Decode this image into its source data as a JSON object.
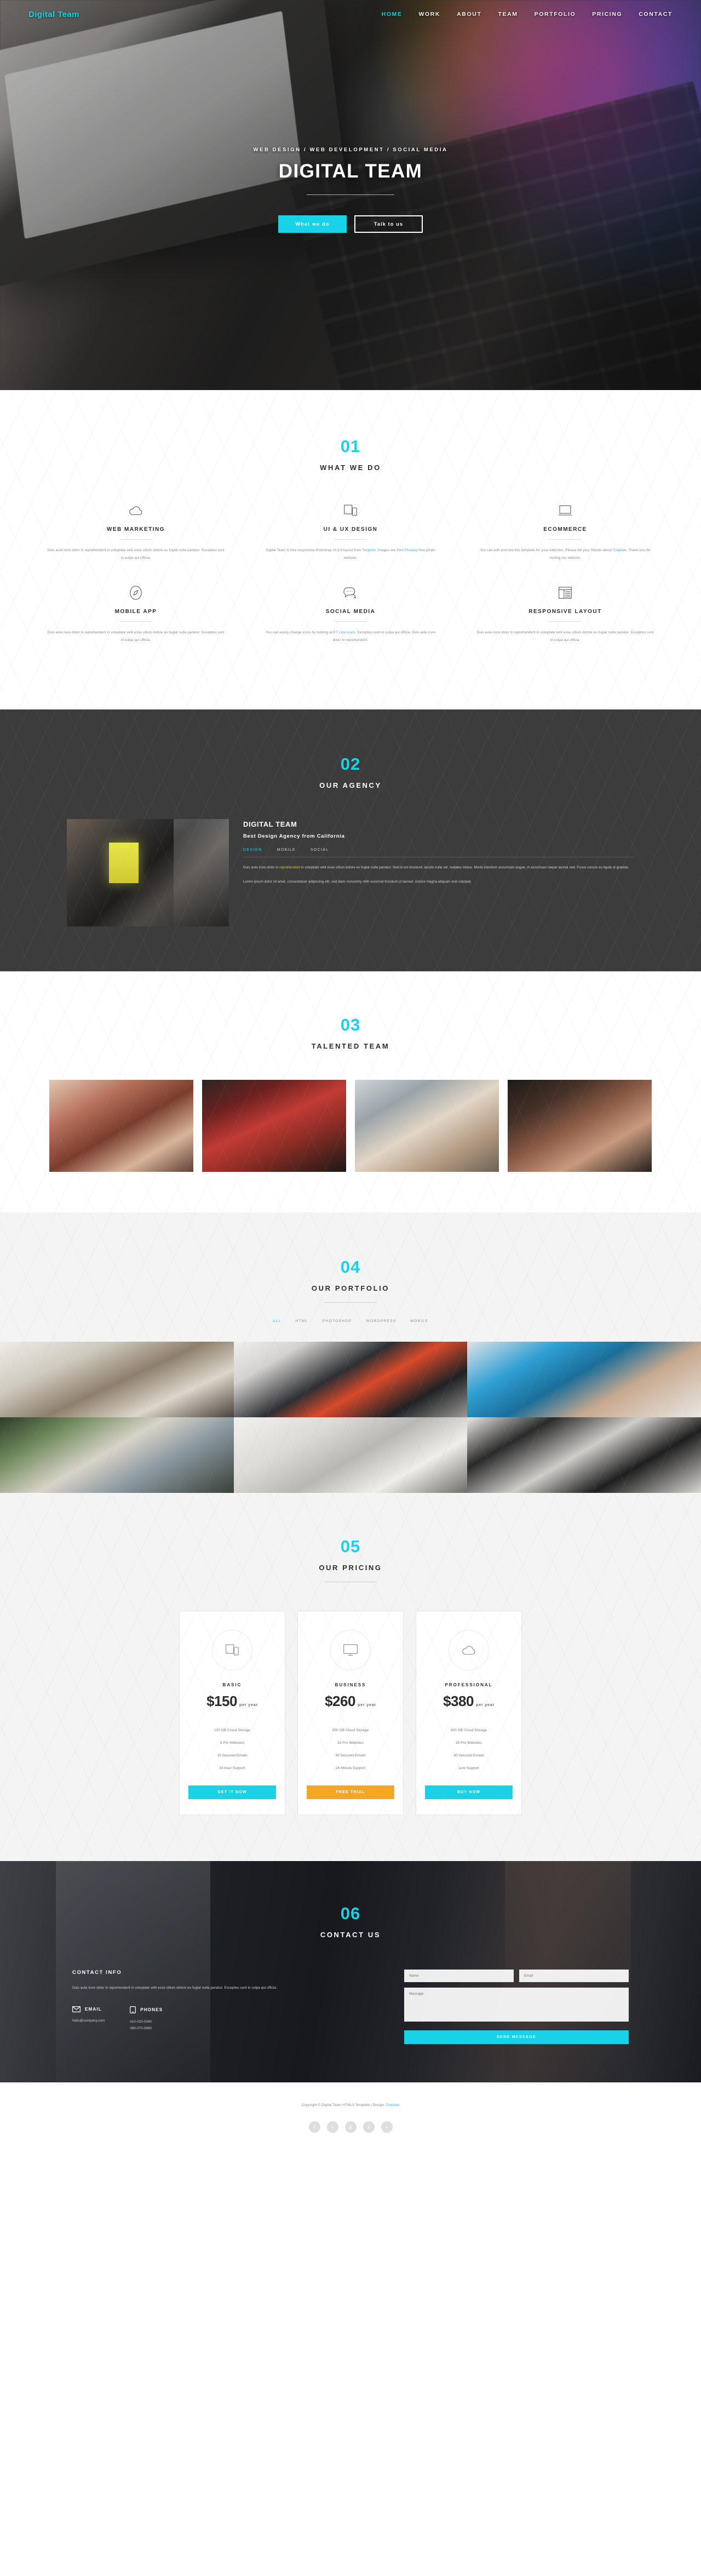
{
  "brand": "Digital Team",
  "nav": {
    "items": [
      {
        "label": "HOME",
        "active": true
      },
      {
        "label": "WORK",
        "active": false
      },
      {
        "label": "ABOUT",
        "active": false
      },
      {
        "label": "TEAM",
        "active": false
      },
      {
        "label": "PORTFOLIO",
        "active": false
      },
      {
        "label": "PRICING",
        "active": false
      },
      {
        "label": "CONTACT",
        "active": false
      }
    ]
  },
  "hero": {
    "subtitle": "WEB DESIGN / WEB DEVELOPMENT / SOCIAL MEDIA",
    "title": "DIGITAL TEAM",
    "primary_button": "What we do",
    "secondary_button": "Talk to us"
  },
  "whatwedo": {
    "number": "01",
    "title": "WHAT WE DO",
    "services": [
      {
        "icon": "cloud-icon",
        "name": "WEB MARKETING",
        "text": "Duis aute irure dolor in reprehenderit in voluptate velit esse cillum dolore eu fugiat nulla pariatur. Excepteu sunt in culpa qui officia."
      },
      {
        "icon": "devices-icon",
        "name": "UI & UX DESIGN",
        "text": "Digital Team is free responsive Bootstrap v3.3.5 layout from Tooplate. Images are from Pixabay free photo website."
      },
      {
        "icon": "laptop-icon",
        "name": "ECOMMERCE",
        "text": "You can edit and use this template for your websites. Please tell your friends about Tooplate. Thank you for visiting our website."
      },
      {
        "icon": "compass-icon",
        "name": "MOBILE APP",
        "text": "Duis aute irure dolor in reprehenderit in voluptate velit esse cillum dolore eu fugiat nulla pariatur. Excepteu sunt in culpa qui officia."
      },
      {
        "icon": "chat-icon",
        "name": "SOCIAL MEDIA",
        "text": "You can easily change icons by looking at ET Line Icons. Excepteu sunt in culpa qui officia. Duis aute irure dolor in reprehenderit."
      },
      {
        "icon": "layout-icon",
        "name": "RESPONSIVE LAYOUT",
        "text": "Duis aute irure dolor in reprehenderit in voluptate velit esse cillum dolore eu fugiat nulla pariatur. Excepteu sunt in culpa qui officia."
      }
    ]
  },
  "agency": {
    "number": "02",
    "title": "OUR AGENCY",
    "heading": "DIGITAL TEAM",
    "subheading": "Best Design Agency from California",
    "tabs": [
      {
        "label": "DESIGN",
        "active": true
      },
      {
        "label": "MOBILE",
        "active": false
      },
      {
        "label": "SOCIAL",
        "active": false
      }
    ],
    "paragraph_1_pre": "Duis aute irure dolor in ",
    "paragraph_1_hl": "reprehenderit",
    "paragraph_1_post": " in voluptate velit esse cillum dolore eu fugiat nulla pariatur. Sed id est tincidunt, iaculis nulla vel, sodales metus. Morbi interdum accumsan augue, in accumsan neque lacinia sed. Fusce cursus eu ligula ut gravida.",
    "paragraph_2": "Lorem ipsum dolor sit amet, consectetuer adipiscing elit, sed diam nonummy nibh euismod tincidunt ut laoreet. Dolore magna aliquam erat volutpat."
  },
  "team": {
    "number": "03",
    "title": "TALENTED TEAM",
    "members": [
      {
        "name": "team-member-1"
      },
      {
        "name": "team-member-2"
      },
      {
        "name": "team-member-3"
      },
      {
        "name": "team-member-4"
      }
    ]
  },
  "portfolio": {
    "number": "04",
    "title": "OUR PORTFOLIO",
    "filters": [
      {
        "label": "ALL",
        "active": true
      },
      {
        "label": "HTML",
        "active": false
      },
      {
        "label": "PHOTOSHOP",
        "active": false
      },
      {
        "label": "WORDPRESS",
        "active": false
      },
      {
        "label": "MOBILE",
        "active": false
      }
    ],
    "items": [
      {
        "name": "portfolio-item-1"
      },
      {
        "name": "portfolio-item-2"
      },
      {
        "name": "portfolio-item-3"
      },
      {
        "name": "portfolio-item-4"
      },
      {
        "name": "portfolio-item-5"
      },
      {
        "name": "portfolio-item-6"
      }
    ]
  },
  "pricing": {
    "number": "05",
    "title": "OUR PRICING",
    "plans": [
      {
        "icon": "devices-icon",
        "name": "BASIC",
        "price": "$150",
        "period": "per year",
        "features": [
          "100 GB Cloud Storage",
          "5 Pro Websites",
          "10 Secured Emails",
          "24-hour Support"
        ],
        "button": "GET IT NOW",
        "button_color": "#18d3e8"
      },
      {
        "icon": "monitor-icon",
        "name": "BUSINESS",
        "price": "$260",
        "period": "per year",
        "features": [
          "500 GB Cloud Storage",
          "24 Pro Websites",
          "30 Secured Emails",
          "24-Minute Support"
        ],
        "button": "FREE TRIAL",
        "button_color": "#f5a623"
      },
      {
        "icon": "cloud-icon",
        "name": "PROFESSIONAL",
        "price": "$380",
        "period": "per year",
        "features": [
          "900 GB Cloud Storage",
          "28 Pro Websites",
          "40 Secured Emails",
          "Live Support"
        ],
        "button": "BUY NOW",
        "button_color": "#18d3e8"
      }
    ]
  },
  "contact": {
    "number": "06",
    "title": "CONTACT US",
    "info_heading": "CONTACT INFO",
    "info_text": "Duis aute irure dolor in reprehenderit in voluptate velit esse cillum dolore eu fugiat nulla pariatur. Excepteu sunt in culpa qui officia.",
    "email_label": "EMAIL",
    "email_value": "hello@company.com",
    "phones_label": "PHONES",
    "phones_value": "010-020-0340\n060-070-0890",
    "form": {
      "name_placeholder": "Name",
      "email_placeholder": "Email",
      "message_placeholder": "Message",
      "submit_label": "SEND MESSAGE"
    }
  },
  "footer": {
    "copyright_pre": "Copyright © Digital Team HTML5 Template | Design: ",
    "copyright_link": "Tooplate",
    "socials": [
      {
        "icon": "facebook-icon",
        "glyph": "f"
      },
      {
        "icon": "twitter-icon",
        "glyph": "t"
      },
      {
        "icon": "google-plus-icon",
        "glyph": "g"
      },
      {
        "icon": "instagram-icon",
        "glyph": "i"
      },
      {
        "icon": "tumblr-icon",
        "glyph": "t"
      }
    ]
  },
  "colors": {
    "accent": "#18d3e8",
    "dark": "#3c3c3c",
    "amber": "#f5a623"
  }
}
